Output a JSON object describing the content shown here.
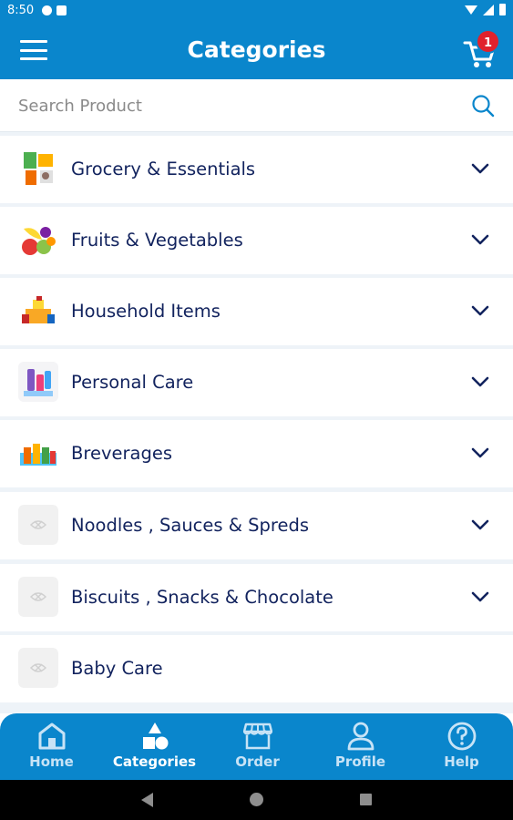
{
  "status_bar": {
    "time": "8:50"
  },
  "app_bar": {
    "title": "Categories",
    "cart_count": "1"
  },
  "search": {
    "placeholder": "Search Product"
  },
  "categories": [
    {
      "name": "Grocery & Essentials",
      "icon": "grocery-image",
      "expandable": true
    },
    {
      "name": "Fruits & Vegetables",
      "icon": "fruits-image",
      "expandable": true
    },
    {
      "name": "Household Items",
      "icon": "household-image",
      "expandable": true
    },
    {
      "name": "Personal Care",
      "icon": "personal-care-image",
      "expandable": true
    },
    {
      "name": "Breverages",
      "icon": "beverages-image",
      "expandable": true
    },
    {
      "name": "Noodles , Sauces & Spreds",
      "icon": "placeholder-image",
      "expandable": true
    },
    {
      "name": "Biscuits , Snacks & Chocolate",
      "icon": "placeholder-image",
      "expandable": true
    },
    {
      "name": "Baby Care",
      "icon": "placeholder-image",
      "expandable": false
    }
  ],
  "bottom_nav": [
    {
      "label": "Home",
      "icon": "home-icon",
      "active": false
    },
    {
      "label": "Categories",
      "icon": "categories-icon",
      "active": true
    },
    {
      "label": "Order",
      "icon": "store-icon",
      "active": false
    },
    {
      "label": "Profile",
      "icon": "profile-icon",
      "active": false
    },
    {
      "label": "Help",
      "icon": "help-icon",
      "active": false
    }
  ],
  "colors": {
    "primary": "#0a86cc",
    "text_dark": "#12235e",
    "badge": "#e0222c",
    "list_background": "#eef3f8"
  }
}
